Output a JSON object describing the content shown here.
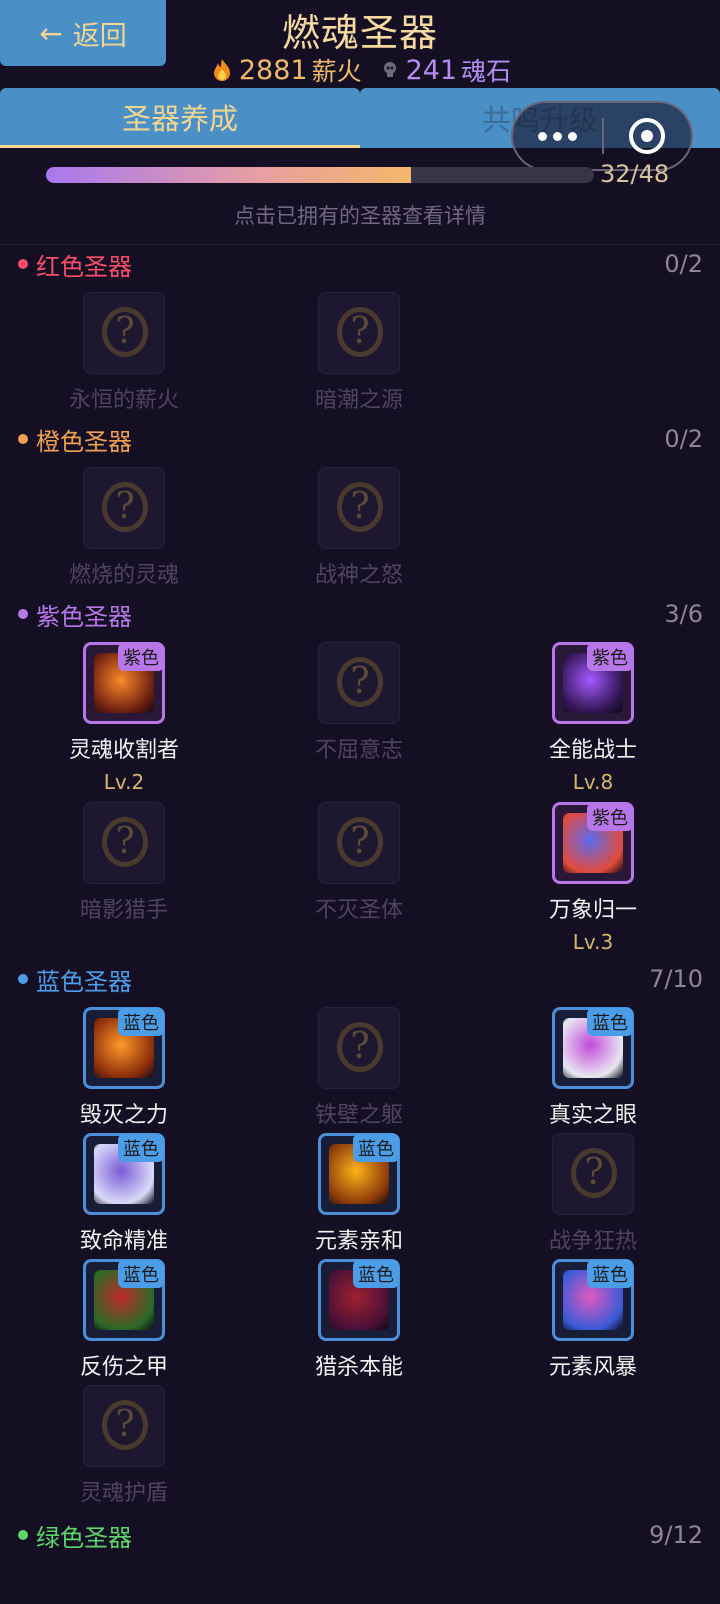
{
  "header": {
    "back_label": "返回",
    "title": "燃魂圣器",
    "fire_count": "2881",
    "fire_unit": "薪火",
    "soul_count": "241",
    "soul_unit": "魂石"
  },
  "tabs": [
    {
      "label": "圣器养成",
      "active": true
    },
    {
      "label": "共鸣升级",
      "active": false
    }
  ],
  "progress": {
    "text": "32/48",
    "fraction": 0.6667
  },
  "hint": "点击已拥有的圣器查看详情",
  "sections": [
    {
      "name": "红色圣器",
      "count": "0/2",
      "color": "#ff4d6a",
      "items": [
        {
          "name": "永恒的薪火",
          "owned": false
        },
        {
          "name": "暗潮之源",
          "owned": false
        }
      ]
    },
    {
      "name": "橙色圣器",
      "count": "0/2",
      "color": "#f0a050",
      "items": [
        {
          "name": "燃烧的灵魂",
          "owned": false
        },
        {
          "name": "战神之怒",
          "owned": false
        }
      ]
    },
    {
      "name": "紫色圣器",
      "count": "3/6",
      "color": "#b877e8",
      "items": [
        {
          "name": "灵魂收割者",
          "owned": true,
          "badge": "紫色",
          "level": "Lv.2"
        },
        {
          "name": "不屈意志",
          "owned": false
        },
        {
          "name": "全能战士",
          "owned": true,
          "badge": "紫色",
          "level": "Lv.8"
        },
        {
          "name": "暗影猎手",
          "owned": false
        },
        {
          "name": "不灭圣体",
          "owned": false
        },
        {
          "name": "万象归一",
          "owned": true,
          "badge": "紫色",
          "level": "Lv.3"
        }
      ]
    },
    {
      "name": "蓝色圣器",
      "count": "7/10",
      "color": "#4c9de8",
      "items": [
        {
          "name": "毁灭之力",
          "owned": true,
          "badge": "蓝色"
        },
        {
          "name": "铁壁之躯",
          "owned": false
        },
        {
          "name": "真实之眼",
          "owned": true,
          "badge": "蓝色"
        },
        {
          "name": "致命精准",
          "owned": true,
          "badge": "蓝色"
        },
        {
          "name": "元素亲和",
          "owned": true,
          "badge": "蓝色"
        },
        {
          "name": "战争狂热",
          "owned": false
        },
        {
          "name": "反伤之甲",
          "owned": true,
          "badge": "蓝色"
        },
        {
          "name": "猎杀本能",
          "owned": true,
          "badge": "蓝色"
        },
        {
          "name": "元素风暴",
          "owned": true,
          "badge": "蓝色"
        },
        {
          "name": "灵魂护盾",
          "owned": false
        }
      ]
    },
    {
      "name": "绿色圣器",
      "count": "9/12",
      "color": "#5cd66a",
      "items": []
    }
  ]
}
